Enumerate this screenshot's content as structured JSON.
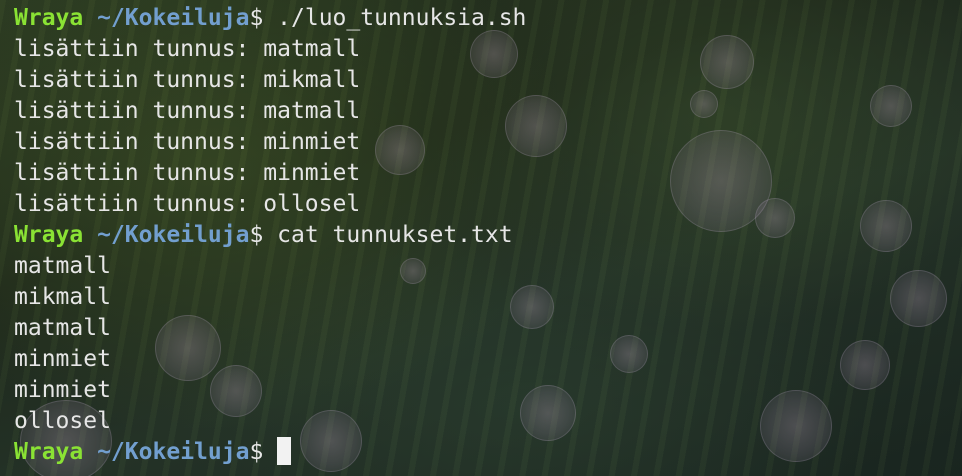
{
  "prompt": {
    "user": "Wraya",
    "path": "~/Kokeiluja",
    "symbol": "$"
  },
  "commands": [
    "./luo_tunnuksia.sh",
    "cat tunnukset.txt"
  ],
  "script_output": [
    "lisättiin tunnus: matmall",
    "lisättiin tunnus: mikmall",
    "lisättiin tunnus: matmall",
    "lisättiin tunnus: minmiet",
    "lisättiin tunnus: minmiet",
    "lisättiin tunnus: ollosel"
  ],
  "file_output": [
    "matmall",
    "mikmall",
    "matmall",
    "minmiet",
    "minmiet",
    "ollosel"
  ],
  "colors": {
    "user": "#8ae234",
    "path": "#729fcf",
    "text": "#e6e6e6"
  }
}
